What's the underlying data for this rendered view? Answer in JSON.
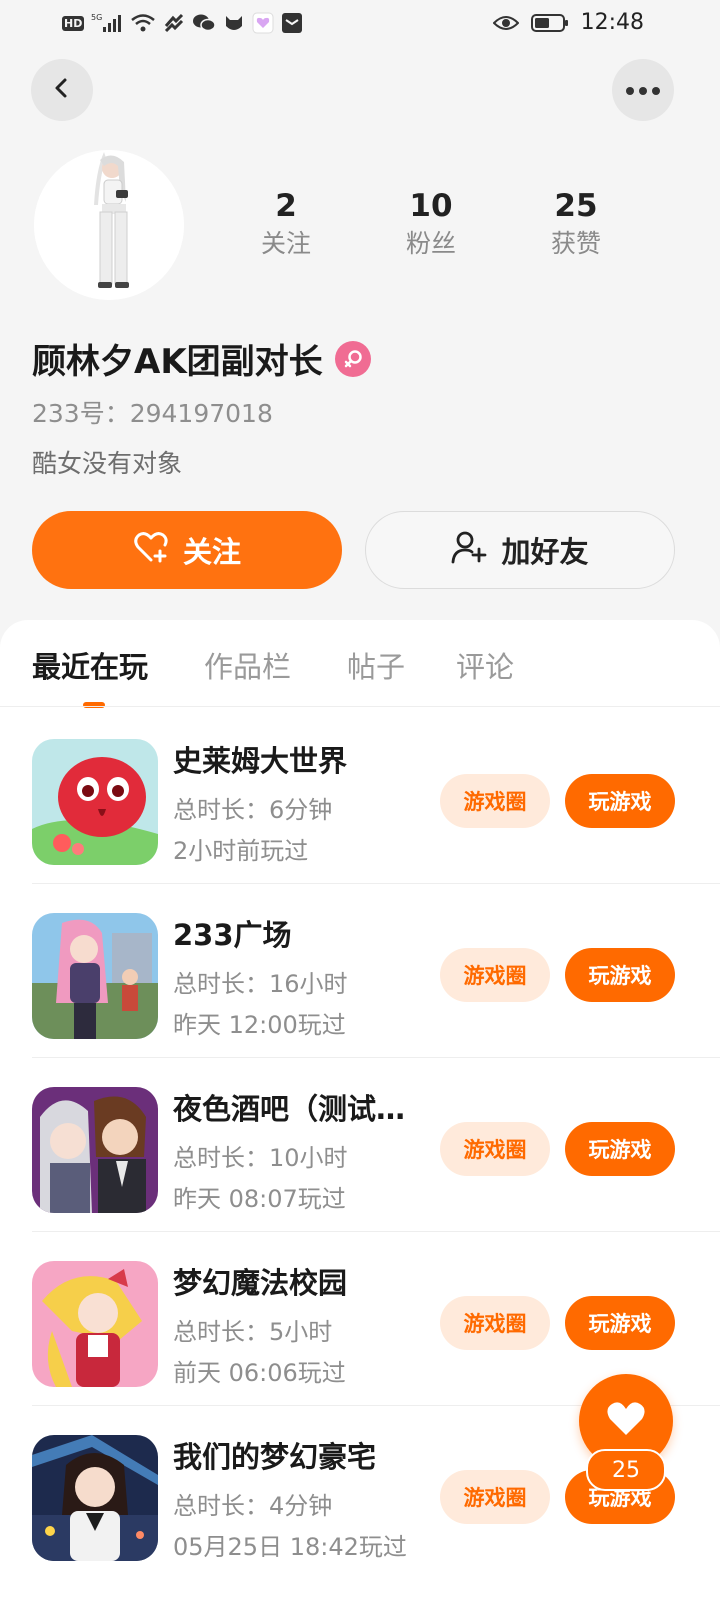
{
  "status_bar": {
    "hd": "HD",
    "network": "5G",
    "time": "12:48",
    "icons": [
      "hd-icon",
      "signal-icon",
      "wifi-icon",
      "sync-icon",
      "wechat-icon",
      "cat-app-icon",
      "heart-app-icon",
      "mail-app-icon",
      "eye-icon",
      "battery-icon"
    ]
  },
  "nav": {
    "back_icon": "chevron-left-icon",
    "more_icon": "more-dots-icon"
  },
  "profile": {
    "stats": [
      {
        "value": "2",
        "label": "关注"
      },
      {
        "value": "10",
        "label": "粉丝"
      },
      {
        "value": "25",
        "label": "获赞"
      }
    ],
    "name": "顾林夕AK团副对长",
    "gender_icon": "female-icon",
    "uid": "233号：294197018",
    "bio": "酷女没有对象",
    "follow_label": "关注",
    "add_friend_label": "加好友"
  },
  "tabs": [
    {
      "label": "最近在玩",
      "active": true
    },
    {
      "label": "作品栏",
      "active": false
    },
    {
      "label": "帖子",
      "active": false
    },
    {
      "label": "评论",
      "active": false
    }
  ],
  "games": [
    {
      "title": "史莱姆大世界",
      "duration": "总时长：6分钟",
      "last_played": "2小时前玩过",
      "circle_label": "游戏圈",
      "play_label": "玩游戏"
    },
    {
      "title": "233广场",
      "duration": "总时长：16小时",
      "last_played": "昨天 12:00玩过",
      "circle_label": "游戏圈",
      "play_label": "玩游戏"
    },
    {
      "title": "夜色酒吧（测试…",
      "duration": "总时长：10小时",
      "last_played": "昨天 08:07玩过",
      "circle_label": "游戏圈",
      "play_label": "玩游戏"
    },
    {
      "title": "梦幻魔法校园",
      "duration": "总时长：5小时",
      "last_played": "前天 06:06玩过",
      "circle_label": "游戏圈",
      "play_label": "玩游戏"
    },
    {
      "title": "我们的梦幻豪宅",
      "duration": "总时长：4分钟",
      "last_played": "05月25日 18:42玩过",
      "circle_label": "游戏圈",
      "play_label": "玩游戏"
    }
  ],
  "like_fab": {
    "count": "25"
  },
  "colors": {
    "accent": "#ff6a00",
    "accent_light": "#ffeadb",
    "background": "#f5f5f5"
  }
}
